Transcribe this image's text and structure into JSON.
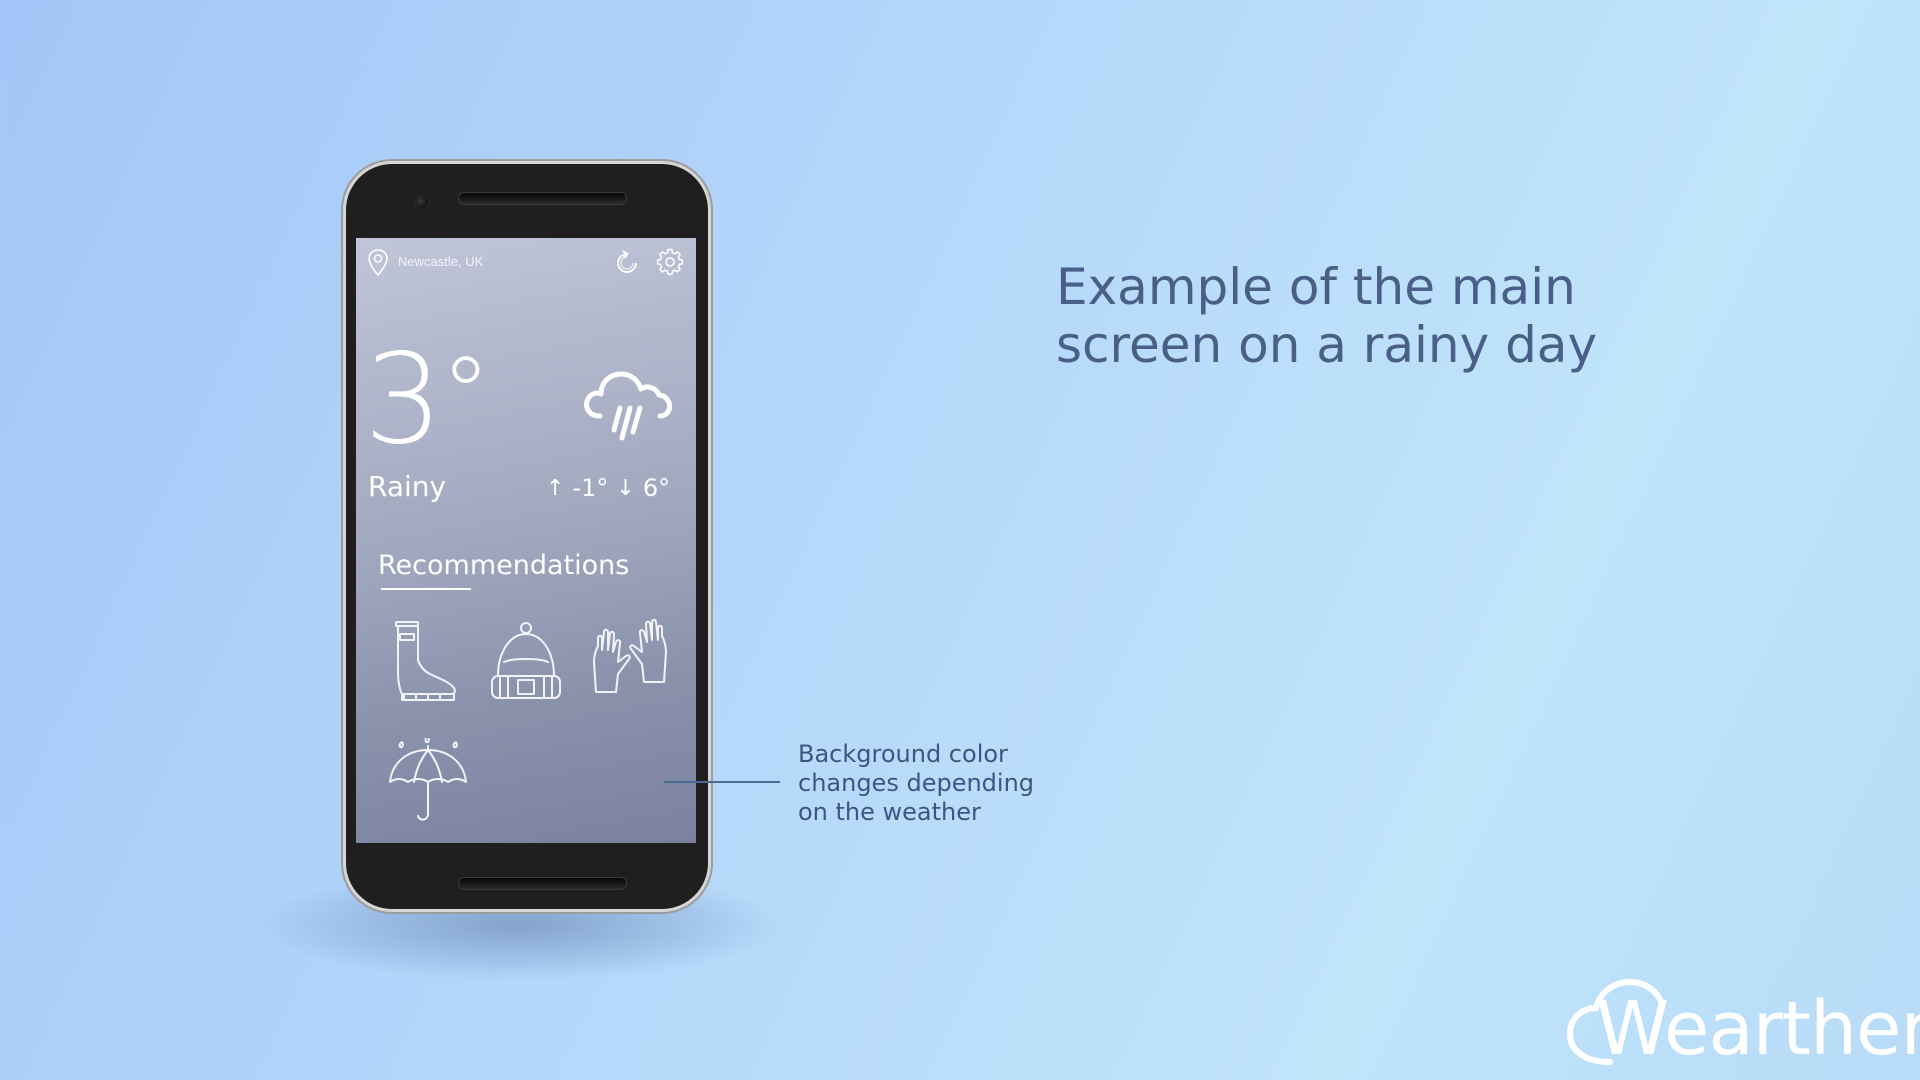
{
  "phone": {
    "location": "Newcastle, UK",
    "temperature": "3",
    "degree_symbol": "°",
    "condition": "Rainy",
    "min_temp": "-1°",
    "max_temp": "6°",
    "recommendations_title": "Recommendations",
    "recommendations": [
      "rain-boots",
      "beanie-hat",
      "gloves",
      "umbrella"
    ],
    "weather_icon": "rain-cloud-icon",
    "screen_color": "#9aa1b8"
  },
  "headline": {
    "line1": "Example of the main",
    "line2": "screen on a rainy day"
  },
  "annotation": {
    "line1": "Background color",
    "line2": "changes depending",
    "line3": "on the weather"
  },
  "brand": {
    "name": "Wearther"
  },
  "colors": {
    "background_start": "#a4c6f8",
    "background_end": "#c0e4fa",
    "headline": "#4a5f88",
    "annotation": "#3c5684"
  }
}
